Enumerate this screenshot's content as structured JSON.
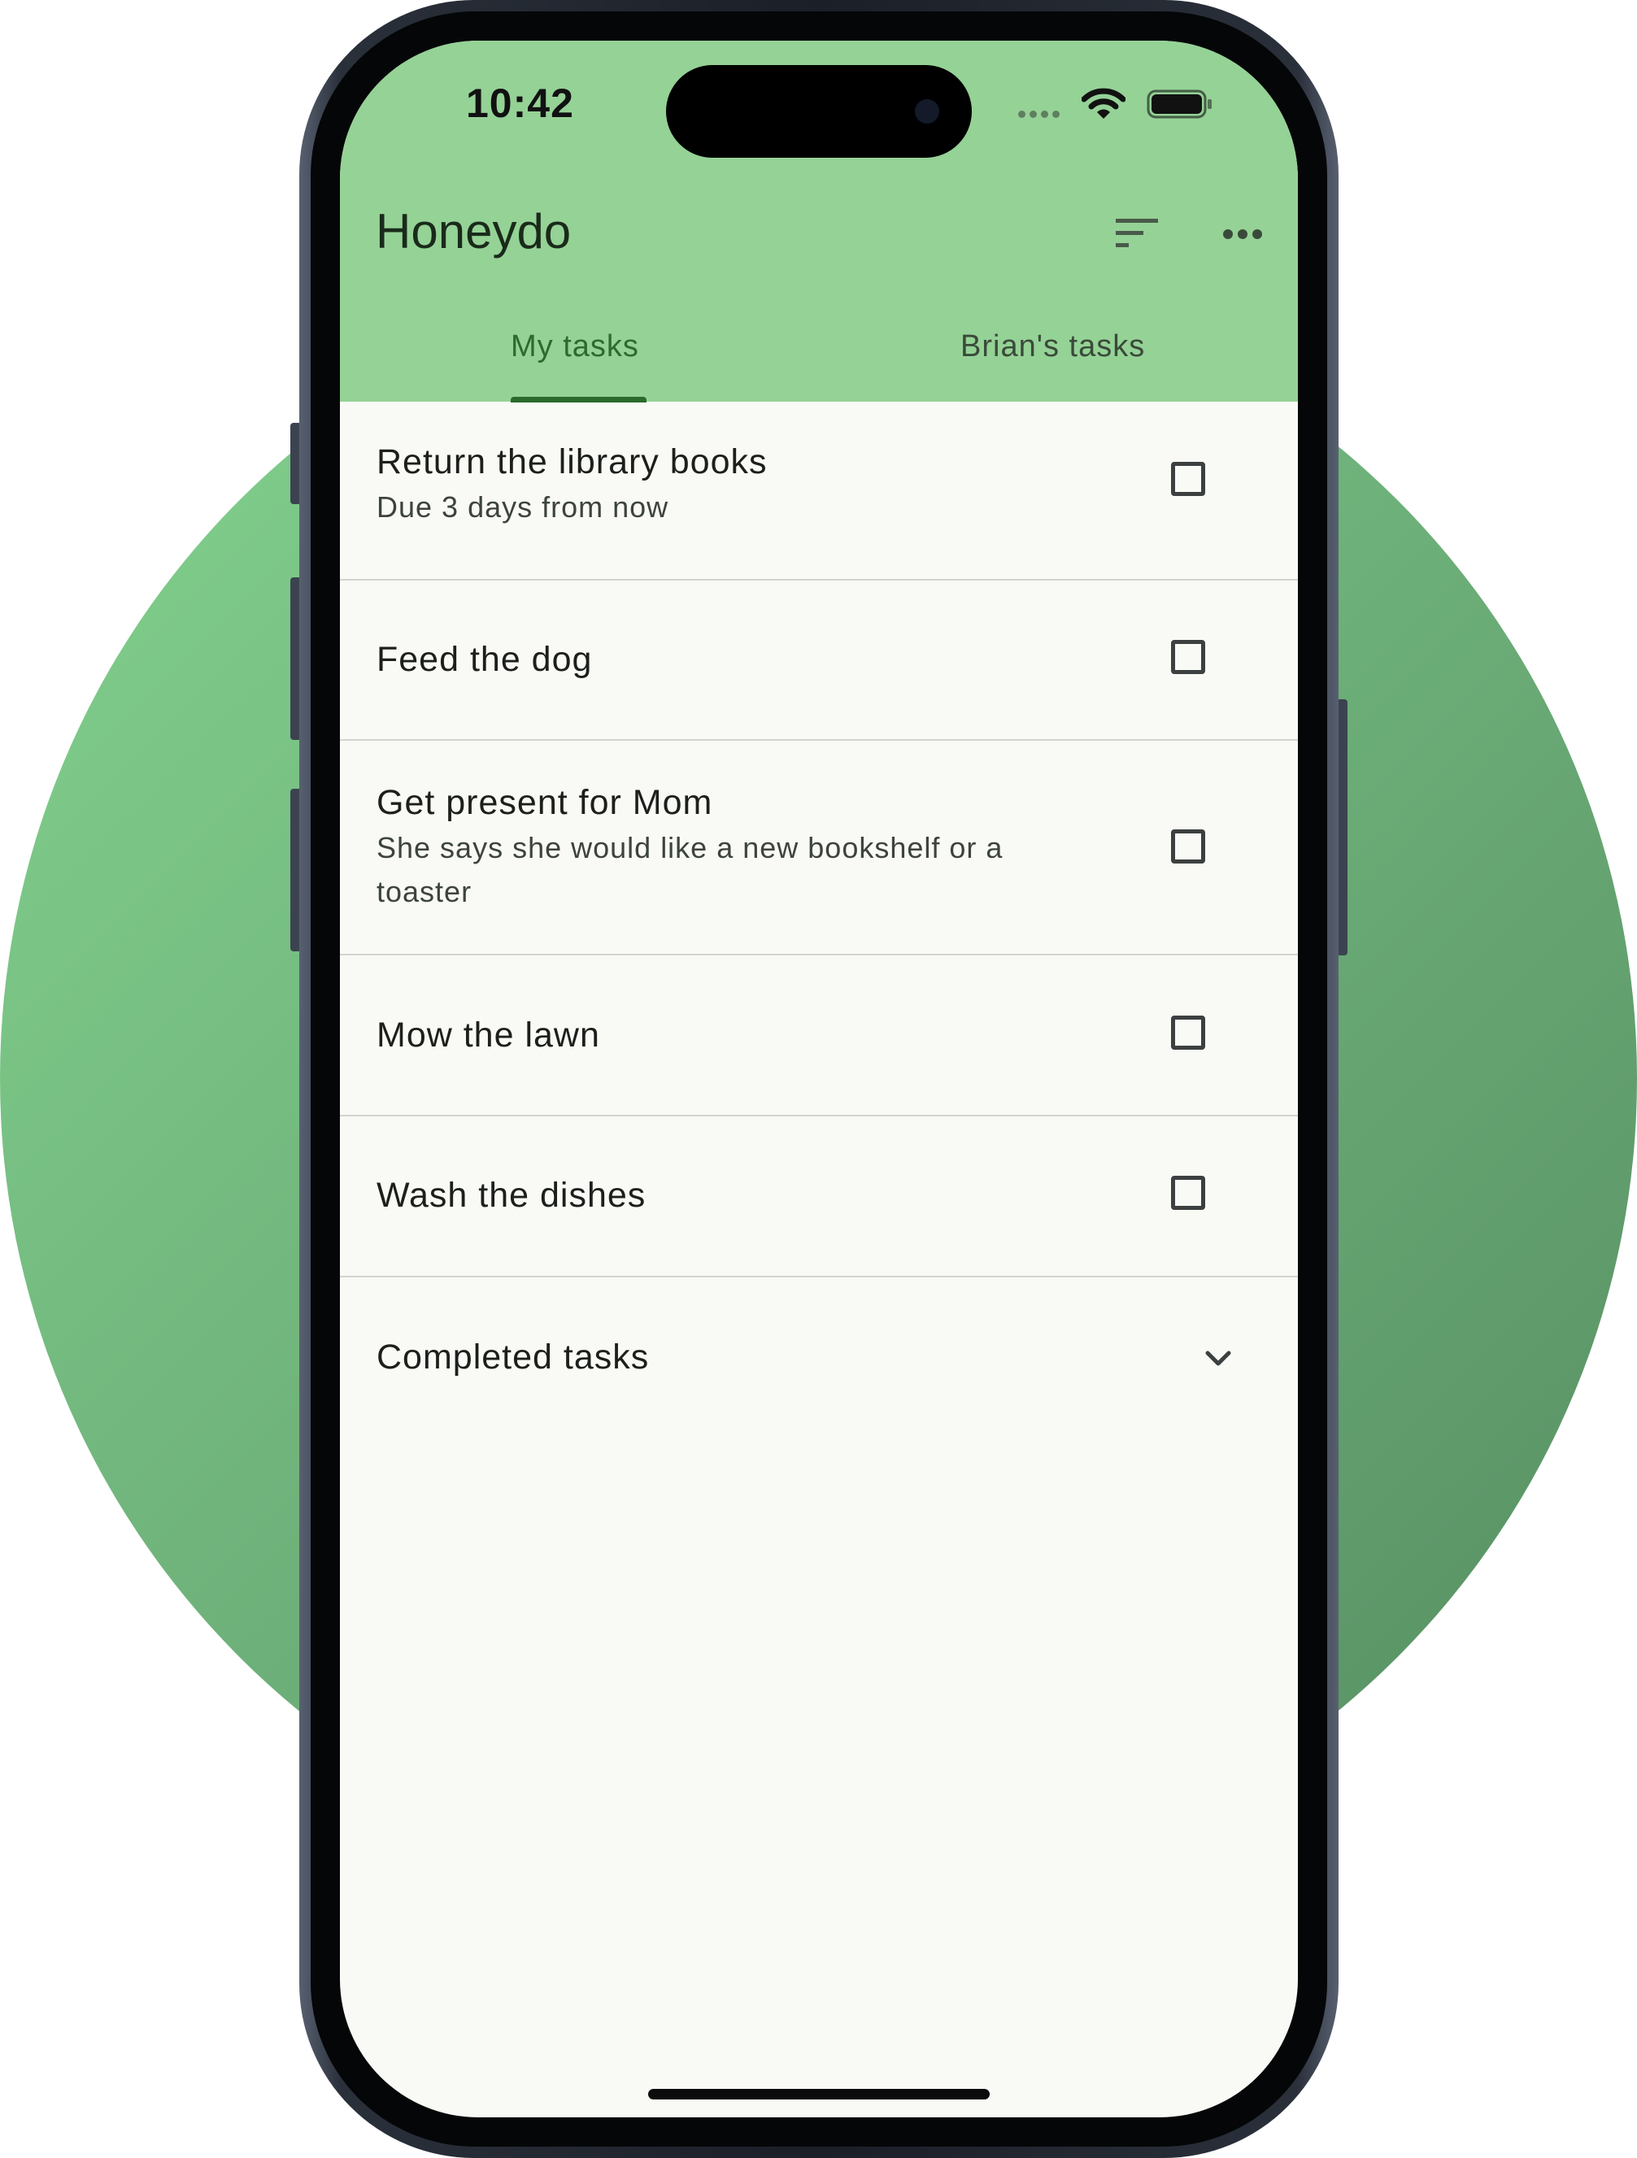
{
  "status_bar": {
    "time": "10:42"
  },
  "app": {
    "title": "Honeydo",
    "accent_color": "#95d296",
    "active_tab_color": "#2c6b2f"
  },
  "icons": {
    "sort": "sort-icon",
    "more": "more-horizontal-icon",
    "wifi": "wifi-icon",
    "battery": "battery-icon",
    "checkbox": "checkbox-empty-icon",
    "expand": "chevron-down-icon"
  },
  "tabs": [
    {
      "label": "My tasks",
      "selected": true
    },
    {
      "label": "Brian's tasks",
      "selected": false
    }
  ],
  "tasks": [
    {
      "title": "Return the library books",
      "subtitle": "Due 3 days from now",
      "checked": false
    },
    {
      "title": "Feed the dog",
      "subtitle": "",
      "checked": false
    },
    {
      "title": "Get present for Mom",
      "subtitle": "She says she would like a new bookshelf or a toaster",
      "checked": false
    },
    {
      "title": "Mow the lawn",
      "subtitle": "",
      "checked": false
    },
    {
      "title": "Wash the dishes",
      "subtitle": "",
      "checked": false
    }
  ],
  "completed_section": {
    "label": "Completed tasks",
    "expanded": false
  }
}
